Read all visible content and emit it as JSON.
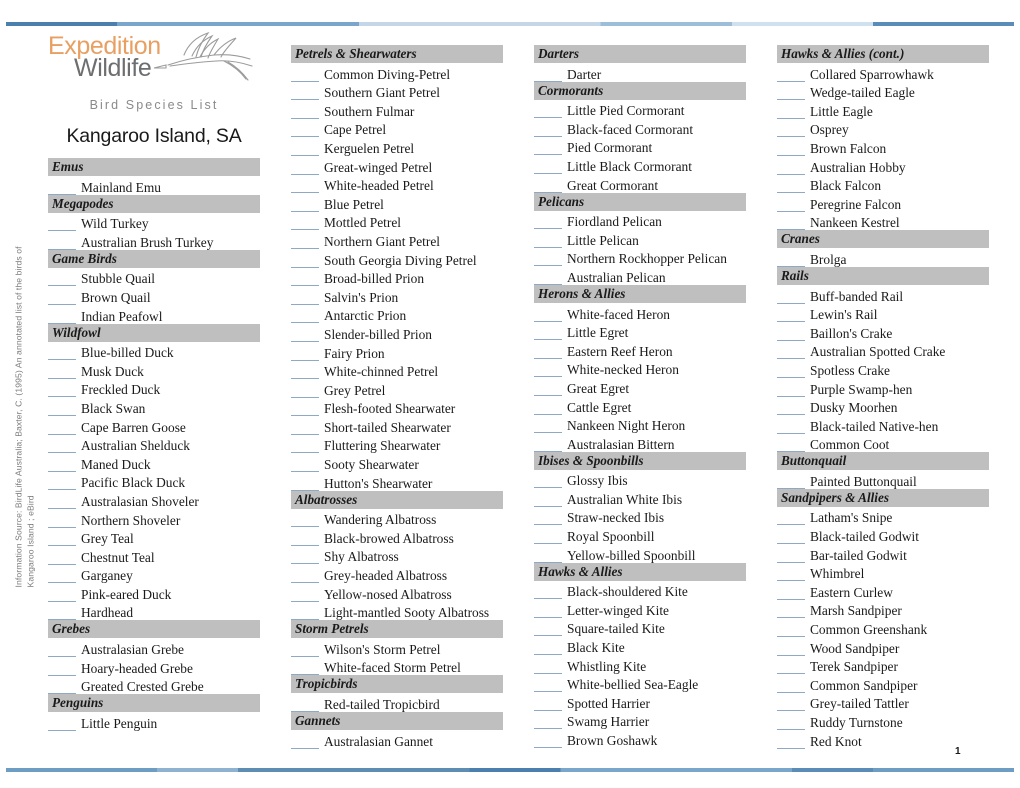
{
  "document": {
    "logo": {
      "word_one": "Expedition",
      "word_two": "Wildlife",
      "bird_icon": "hummingbird-line-art"
    },
    "subtitle": "Bird Species List",
    "place_title": "Kangaroo Island, SA",
    "source_credit": "Information Source: BirdLife Australia; Baxter, C. (1995) An annotated list of the birds of Kangaroo Island ; eBird",
    "page_number": "1",
    "colors": {
      "group_header_bg": "#bfbfbf",
      "blank_line": "#8fa9c4",
      "logo_orange": "#e8a062",
      "logo_gray": "#6d6e70",
      "rule_blue": "#4a7fae"
    }
  },
  "columns": [
    {
      "groups": [
        {
          "name": "Emus",
          "species": [
            "Mainland Emu"
          ]
        },
        {
          "name": "Megapodes",
          "species": [
            "Wild Turkey",
            "Australian Brush Turkey"
          ]
        },
        {
          "name": "Game Birds",
          "species": [
            "Stubble Quail",
            "Brown Quail",
            "Indian Peafowl"
          ]
        },
        {
          "name": "Wildfowl",
          "species": [
            "Blue-billed Duck",
            "Musk Duck",
            "Freckled Duck",
            "Black Swan",
            "Cape Barren Goose",
            "Australian Shelduck",
            "Maned Duck",
            "Pacific Black Duck",
            "Australasian Shoveler",
            "Northern Shoveler",
            "Grey Teal",
            "Chestnut Teal",
            "Garganey",
            "Pink-eared Duck",
            "Hardhead"
          ]
        },
        {
          "name": "Grebes",
          "species": [
            "Australasian Grebe",
            "Hoary-headed Grebe",
            "Greated Crested Grebe"
          ]
        },
        {
          "name": "Penguins",
          "species": [
            "Little Penguin"
          ]
        }
      ]
    },
    {
      "groups": [
        {
          "name": "Petrels & Shearwaters",
          "species": [
            "Common Diving-Petrel",
            "Southern Giant Petrel",
            "Southern Fulmar",
            "Cape Petrel",
            "Kerguelen Petrel",
            "Great-winged Petrel",
            "White-headed Petrel",
            "Blue Petrel",
            "Mottled Petrel",
            "Northern Giant Petrel",
            "South Georgia Diving Petrel",
            "Broad-billed Prion",
            "Salvin's Prion",
            "Antarctic Prion",
            "Slender-billed Prion",
            "Fairy Prion",
            "White-chinned Petrel",
            "Grey Petrel",
            "Flesh-footed Shearwater",
            "Short-tailed Shearwater",
            "Fluttering Shearwater",
            "Sooty Shearwater",
            "Hutton's Shearwater"
          ]
        },
        {
          "name": "Albatrosses",
          "species": [
            "Wandering Albatross",
            "Black-browed Albatross",
            "Shy Albatross",
            "Grey-headed Albatross",
            "Yellow-nosed Albatross",
            "Light-mantled Sooty Albatross"
          ]
        },
        {
          "name": "Storm Petrels",
          "species": [
            "Wilson's Storm Petrel",
            "White-faced Storm Petrel"
          ]
        },
        {
          "name": "Tropicbirds",
          "species": [
            "Red-tailed Tropicbird"
          ]
        },
        {
          "name": "Gannets",
          "species": [
            "Australasian Gannet"
          ]
        }
      ]
    },
    {
      "groups": [
        {
          "name": "Darters",
          "species": [
            "Darter"
          ]
        },
        {
          "name": "Cormorants",
          "species": [
            "Little Pied Cormorant",
            "Black-faced Cormorant",
            "Pied Cormorant",
            "Little Black Cormorant",
            "Great Cormorant"
          ]
        },
        {
          "name": "Pelicans",
          "species": [
            "Fiordland Pelican",
            "Little Pelican",
            "Northern Rockhopper Pelican",
            "Australian Pelican"
          ]
        },
        {
          "name": "Herons & Allies",
          "species": [
            "White-faced Heron",
            "Little Egret",
            "Eastern Reef Heron",
            "White-necked Heron",
            "Great Egret",
            "Cattle Egret",
            "Nankeen Night Heron",
            "Australasian Bittern"
          ]
        },
        {
          "name": "Ibises & Spoonbills",
          "species": [
            "Glossy Ibis",
            "Australian White Ibis",
            "Straw-necked Ibis",
            "Royal Spoonbill",
            "Yellow-billed Spoonbill"
          ]
        },
        {
          "name": "Hawks & Allies",
          "species": [
            "Black-shouldered Kite",
            "Letter-winged Kite",
            "Square-tailed Kite",
            "Black Kite",
            "Whistling Kite",
            "White-bellied Sea-Eagle",
            "Spotted Harrier",
            "Swamg Harrier",
            "Brown Goshawk"
          ]
        }
      ]
    },
    {
      "groups": [
        {
          "name": "Hawks & Allies (cont.)",
          "species": [
            "Collared Sparrowhawk",
            "Wedge-tailed Eagle",
            "Little Eagle",
            "Osprey",
            "Brown Falcon",
            "Australian Hobby",
            "Black Falcon",
            "Peregrine Falcon",
            "Nankeen Kestrel"
          ]
        },
        {
          "name": "Cranes",
          "species": [
            "Brolga"
          ]
        },
        {
          "name": "Rails",
          "species": [
            "Buff-banded Rail",
            "Lewin's Rail",
            "Baillon's Crake",
            "Australian Spotted Crake",
            "Spotless Crake",
            "Purple Swamp-hen",
            "Dusky Moorhen",
            "Black-tailed Native-hen",
            "Common Coot"
          ]
        },
        {
          "name": "Buttonquail",
          "species": [
            "Painted Buttonquail"
          ]
        },
        {
          "name": "Sandpipers & Allies",
          "species": [
            "Latham's Snipe",
            "Black-tailed Godwit",
            "Bar-tailed Godwit",
            "Whimbrel",
            "Eastern Curlew",
            "Marsh Sandpiper",
            "Common Greenshank",
            "Wood Sandpiper",
            "Terek Sandpiper",
            "Common Sandpiper",
            "Grey-tailed Tattler",
            "Ruddy Turnstone",
            "Red Knot"
          ]
        }
      ]
    }
  ]
}
